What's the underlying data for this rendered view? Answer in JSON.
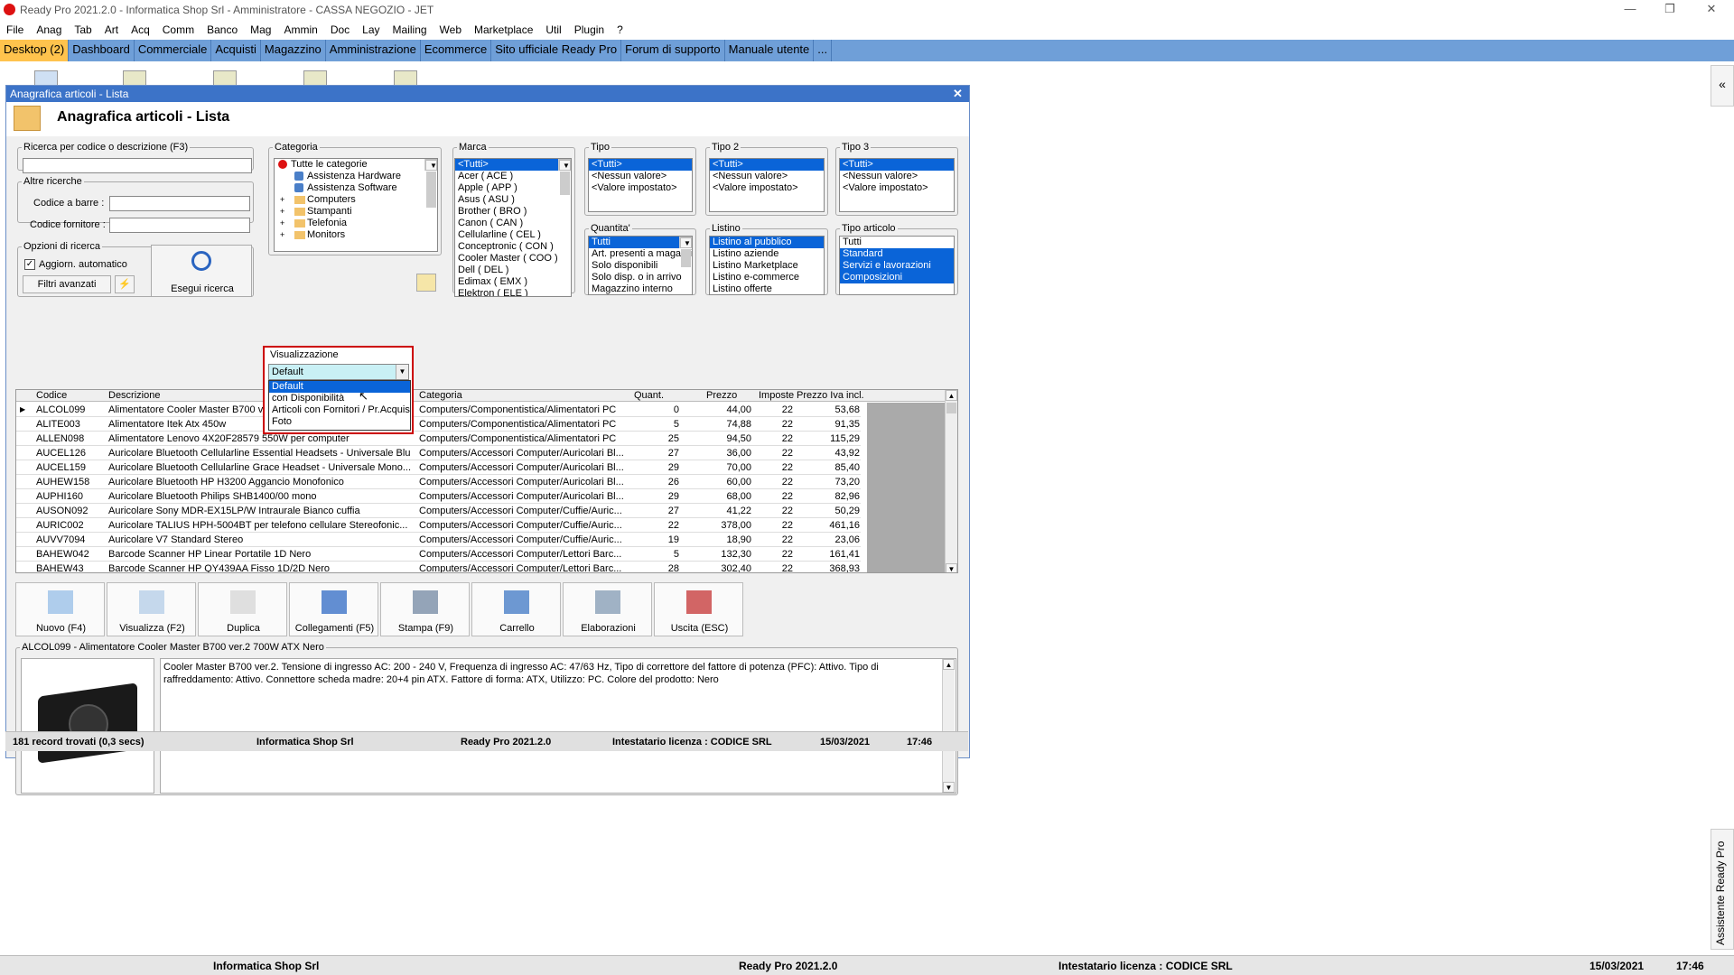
{
  "titlebar": {
    "title": "Ready Pro 2021.2.0 - Informatica Shop Srl - Amministratore - CASSA NEGOZIO - JET"
  },
  "menu": [
    "File",
    "Anag",
    "Tab",
    "Art",
    "Acq",
    "Comm",
    "Banco",
    "Mag",
    "Ammin",
    "Doc",
    "Lay",
    "Mailing",
    "Web",
    "Marketplace",
    "Util",
    "Plugin",
    "?"
  ],
  "nav": [
    "Desktop (2)",
    "Dashboard",
    "Commerciale",
    "Acquisti",
    "Magazzino",
    "Amministrazione",
    "Ecommerce",
    "Sito ufficiale Ready Pro",
    "Forum di supporto",
    "Manuale utente",
    "..."
  ],
  "window": {
    "title": "Anagrafica articoli  - Lista",
    "heading": "Anagrafica articoli  - Lista"
  },
  "search": {
    "legend": "Ricerca per codice o descrizione (F3)",
    "value": "",
    "altre": "Altre ricerche",
    "barcode_label": "Codice a barre :",
    "fornitore_label": "Codice fornitore :",
    "opzioni": "Opzioni di ricerca",
    "aggiorn": "Aggiorn. automatico",
    "filtri": "Filtri avanzati",
    "esegui": "Esegui ricerca"
  },
  "categoria": {
    "legend": "Categoria",
    "items": [
      "Tutte le categorie",
      "Assistenza Hardware",
      "Assistenza Software",
      "Computers",
      "Stampanti",
      "Telefonia",
      "Monitors"
    ]
  },
  "marca": {
    "legend": "Marca",
    "items": [
      "<Tutti>",
      "Acer ( ACE )",
      "Apple ( APP )",
      "Asus ( ASU )",
      "Brother ( BRO )",
      "Canon ( CAN )",
      "Cellularline ( CEL )",
      "Conceptronic ( CON )",
      "Cooler Master ( COO )",
      "Dell ( DEL )",
      "Edimax ( EMX )",
      "Elektron ( ELE )"
    ]
  },
  "tipo": {
    "legend": "Tipo",
    "items": [
      "<Tutti>",
      "<Nessun valore>",
      "<Valore impostato>"
    ]
  },
  "tipo2": {
    "legend": "Tipo 2",
    "items": [
      "<Tutti>",
      "<Nessun valore>",
      "<Valore impostato>"
    ]
  },
  "tipo3": {
    "legend": "Tipo 3",
    "items": [
      "<Tutti>",
      "<Nessun valore>",
      "<Valore impostato>"
    ]
  },
  "quantita": {
    "legend": "Quantita'",
    "items": [
      "Tutti",
      "Art. presenti a magazzino",
      "Solo disponibili",
      "Solo disp. o in arrivo",
      "Magazzino interno"
    ]
  },
  "listino": {
    "legend": "Listino",
    "items": [
      "Listino al pubblico",
      "Listino aziende",
      "Listino Marketplace",
      "Listino e-commerce",
      "Listino offerte"
    ]
  },
  "tipoart": {
    "legend": "Tipo articolo",
    "items": [
      "Tutti",
      "Standard",
      "Servizi e lavorazioni",
      "Composizioni"
    ]
  },
  "visualizzazione": {
    "legend": "Visualizzazione",
    "selected": "Default",
    "options": [
      "Default",
      "con Disponibilità",
      "Articoli con Fornitori / Pr.Acquisto",
      "Foto"
    ]
  },
  "grid": {
    "headers": [
      "Codice",
      "Descrizione",
      "Categoria",
      "Quant.",
      "Prezzo",
      "Imposte",
      "Prezzo Iva incl."
    ],
    "rows": [
      [
        "ALCOL099",
        "Alimentatore Cooler Master B700 ver.2 700W ATX Nero",
        "Computers/Componentistica/Alimentatori PC",
        "0",
        "44,00",
        "22",
        "53,68"
      ],
      [
        "ALITE003",
        "Alimentatore Itek Atx 450w",
        "Computers/Componentistica/Alimentatori PC",
        "5",
        "74,88",
        "22",
        "91,35"
      ],
      [
        "ALLEN098",
        "Alimentatore Lenovo 4X20F28579 550W per computer",
        "Computers/Componentistica/Alimentatori PC",
        "25",
        "94,50",
        "22",
        "115,29"
      ],
      [
        "AUCEL126",
        "Auricolare Bluetooth Cellularline Essential Headsets - Universale Blu",
        "Computers/Accessori Computer/Auricolari Bl...",
        "27",
        "36,00",
        "22",
        "43,92"
      ],
      [
        "AUCEL159",
        "Auricolare Bluetooth Cellularline Grace Headset - Universale Mono...",
        "Computers/Accessori Computer/Auricolari Bl...",
        "29",
        "70,00",
        "22",
        "85,40"
      ],
      [
        "AUHEW158",
        "Auricolare Bluetooth HP H3200 Aggancio Monofonico",
        "Computers/Accessori Computer/Auricolari Bl...",
        "26",
        "60,00",
        "22",
        "73,20"
      ],
      [
        "AUPHI160",
        "Auricolare Bluetooth Philips SHB1400/00 mono",
        "Computers/Accessori Computer/Auricolari Bl...",
        "29",
        "68,00",
        "22",
        "82,96"
      ],
      [
        "AUSON092",
        "Auricolare Sony MDR-EX15LP/W Intraurale Bianco cuffia",
        "Computers/Accessori Computer/Cuffie/Auric...",
        "27",
        "41,22",
        "22",
        "50,29"
      ],
      [
        "AURIC002",
        "Auricolare TALIUS HPH-5004BT per telefono cellulare Stereofonic...",
        "Computers/Accessori Computer/Cuffie/Auric...",
        "22",
        "378,00",
        "22",
        "461,16"
      ],
      [
        "AUVV7094",
        "Auricolare V7 Standard Stereo",
        "Computers/Accessori Computer/Cuffie/Auric...",
        "19",
        "18,90",
        "22",
        "23,06"
      ],
      [
        "BAHEW042",
        "Barcode Scanner HP Linear Portatile 1D Nero",
        "Computers/Accessori Computer/Lettori Barc...",
        "5",
        "132,30",
        "22",
        "161,41"
      ],
      [
        "BAHEW43",
        "Barcode Scanner HP QY439AA Fisso 1D/2D Nero",
        "Computers/Accessori Computer/Lettori Barc...",
        "28",
        "302,40",
        "22",
        "368,93"
      ]
    ]
  },
  "toolbar": [
    "Nuovo (F4)",
    "Visualizza (F2)",
    "Duplica",
    "Collegamenti (F5)",
    "Stampa (F9)",
    "Carrello",
    "Elaborazioni",
    "Uscita (ESC)"
  ],
  "detail": {
    "legend": "ALCOL099 - Alimentatore Cooler Master B700 ver.2 700W ATX Nero",
    "text": "Cooler Master B700 ver.2. Tensione di ingresso AC: 200 - 240 V, Frequenza di ingresso AC: 47/63 Hz, Tipo di correttore del fattore di potenza (PFC): Attivo. Tipo di raffreddamento: Attivo. Connettore scheda madre: 20+4 pin ATX. Fattore di forma: ATX, Utilizzo: PC. Colore del prodotto: Nero"
  },
  "status": {
    "records": "181 record trovati (0,3 secs)",
    "company": "Informatica Shop Srl",
    "version": "Ready Pro 2021.2.0",
    "license": "Intestatario licenza : CODICE SRL",
    "date": "15/03/2021",
    "time": "17:46"
  },
  "bottom": {
    "company": "Informatica Shop Srl",
    "version": "Ready Pro 2021.2.0",
    "license": "Intestatario licenza : CODICE SRL",
    "date": "15/03/2021",
    "time": "17:46"
  },
  "side": {
    "collapse": "«",
    "assistente": "Assistente Ready Pro"
  },
  "colors": {
    "nav": "#6f9fd8",
    "active_tab": "#ffc34d",
    "window_title": "#3c73c8",
    "selection": "#0a64d8",
    "highlight_box": "#cc0000"
  }
}
